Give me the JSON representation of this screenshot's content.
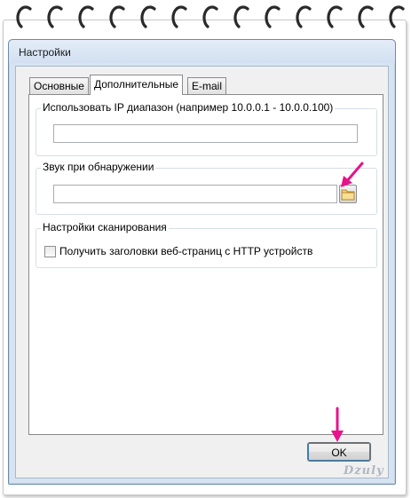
{
  "window": {
    "title": "Настройки"
  },
  "tabs": [
    {
      "label": "Основные",
      "active": false
    },
    {
      "label": "Дополнительные",
      "active": true
    },
    {
      "label": "E-mail",
      "active": false
    }
  ],
  "groups": {
    "ip_range": {
      "label": "Использовать IP диапазон (например 10.0.0.1 - 10.0.0.100)",
      "value": "",
      "placeholder": ""
    },
    "sound": {
      "label": "Звук при обнаружении",
      "value": "",
      "placeholder": ""
    },
    "scan": {
      "label": "Настройки сканирования",
      "checkbox_label": "Получить заголовки веб-страниц с HTTP устройств",
      "checked": false
    }
  },
  "buttons": {
    "ok": "OK"
  },
  "watermark": "Dzuly",
  "colors": {
    "arrow": "#e8128c",
    "window_frame": "#d6e3f2"
  }
}
